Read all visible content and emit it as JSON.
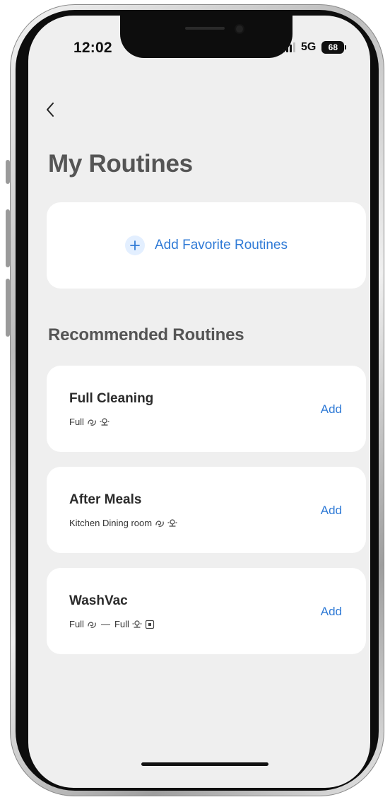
{
  "status_bar": {
    "time": "12:02",
    "network": "5G",
    "battery": "68"
  },
  "page": {
    "title": "My Routines"
  },
  "favorites": {
    "add_label": "Add Favorite Routines"
  },
  "recommended": {
    "section_title": "Recommended Routines",
    "add_label": "Add",
    "routines": [
      {
        "name": "Full Cleaning",
        "desc_prefix": "Full",
        "desc_mid": "",
        "desc_second": ""
      },
      {
        "name": "After Meals",
        "desc_prefix": "Kitchen Dining room",
        "desc_mid": "",
        "desc_second": ""
      },
      {
        "name": "WashVac",
        "desc_prefix": "Full",
        "desc_mid": "—",
        "desc_second": "Full"
      }
    ]
  },
  "colors": {
    "accent": "#2f7ad6",
    "background": "#efefef",
    "card": "#ffffff",
    "title": "#555555"
  },
  "icons": {
    "back": "chevron-left-icon",
    "add": "plus-icon",
    "vacuum": "vacuum-icon",
    "mop": "mop-icon",
    "dock": "dock-icon"
  }
}
